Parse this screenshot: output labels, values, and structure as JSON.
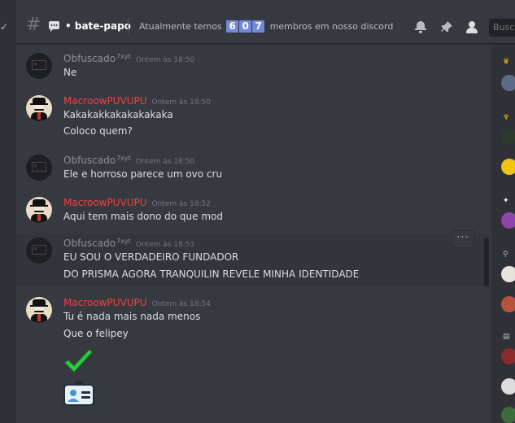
{
  "channel": {
    "name": "bate-papo",
    "topic_prefix": "Atualmente temos",
    "member_digits": [
      "6",
      "0",
      "7"
    ],
    "topic_suffix": "membros em nosso discord",
    "search_placeholder": "Busca"
  },
  "messages": [
    {
      "author": "Obfuscado",
      "author_suffix": "7xyt",
      "author_color": "#8e9297",
      "timestamp": "Ontem às 18:50",
      "lines": [
        "Ne"
      ]
    },
    {
      "author": "MacroowPUVUPU",
      "author_suffix": "",
      "author_color": "#ed4245",
      "timestamp": "Ontem às 18:50",
      "lines": [
        "Kakakakkakakakakaka",
        "Coloco quem?"
      ]
    },
    {
      "author": "Obfuscado",
      "author_suffix": "7xyt",
      "author_color": "#8e9297",
      "timestamp": "Ontem às 18:50",
      "lines": [
        "Ele e horroso parece um ovo cru"
      ]
    },
    {
      "author": "MacroowPUVUPU",
      "author_suffix": "",
      "author_color": "#ed4245",
      "timestamp": "Ontem às 18:52",
      "lines": [
        "Aqui tem mais dono do que mod"
      ]
    },
    {
      "author": "Obfuscado",
      "author_suffix": "7xyt",
      "author_color": "#8e9297",
      "timestamp": "Ontem às 18:53",
      "lines": [
        "EU SOU O VERDADEIRO FUNDADOR",
        "DO PRISMA AGORA TRANQUILIN REVELE MINHA IDENTIDADE"
      ]
    },
    {
      "author": "MacroowPUVUPU",
      "author_suffix": "",
      "author_color": "#ed4245",
      "timestamp": "Ontem às 18:54",
      "lines": [
        "Tu é nada mais nada menos",
        "Que o felipey"
      ]
    }
  ],
  "emojis": [
    "check-mark-emoji",
    "id-card-emoji"
  ],
  "icons": [
    "hash-icon",
    "threads-icon",
    "bell-icon",
    "pin-icon",
    "members-icon",
    "more-icon"
  ],
  "colors": {
    "background": "#36393f",
    "sidebar": "#2f3136",
    "accent": "#7289da",
    "red_name": "#ed4245",
    "grey_name": "#8e9297"
  },
  "more_button_label": "···"
}
